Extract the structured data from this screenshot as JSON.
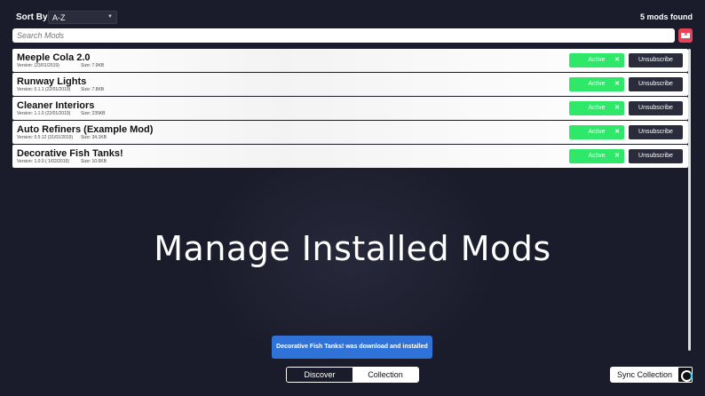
{
  "sort": {
    "label": "Sort By:",
    "value": "A-Z"
  },
  "mods_count": "5 mods found",
  "search": {
    "placeholder": "Search Mods"
  },
  "mods": [
    {
      "title": "Meeple Cola 2.0",
      "version": "Version:    (23/01/2019)",
      "size": "Size: 7.9KB",
      "status": "Active",
      "unsubscribe": "Unsubscribe"
    },
    {
      "title": "Runway Lights",
      "version": "Version: 0.1.1 (22/01/2019)",
      "size": "Size: 7.8KB",
      "status": "Active",
      "unsubscribe": "Unsubscribe"
    },
    {
      "title": "Cleaner Interiors",
      "version": "Version: 1.1.0 (22/01/2019)",
      "size": "Size: 235KB",
      "status": "Active",
      "unsubscribe": "Unsubscribe"
    },
    {
      "title": "Auto Refiners (Example Mod)",
      "version": "Version: 0.5.12 (31/01/2019)",
      "size": "Size: 34.1KB",
      "status": "Active",
      "unsubscribe": "Unsubscribe"
    },
    {
      "title": "Decorative Fish Tanks!",
      "version": "Version: 1.0.0 ( 1/02/2019)",
      "size": "Size: 10.6KB",
      "status": "Active",
      "unsubscribe": "Unsubscribe"
    }
  ],
  "hero_title": "Manage Installed Mods",
  "toast": "Decorative Fish Tanks! was download and installed",
  "tabs": {
    "discover": "Discover",
    "collection": "Collection"
  },
  "sync_label": "Sync Collection",
  "colors": {
    "active": "#2fe86a",
    "accent": "#2f72d8",
    "danger": "#e84259",
    "background": "#1b1c2b"
  },
  "icons": {
    "clear": "backspace-icon",
    "sync": "sync-icon",
    "active_remove": "close-icon"
  }
}
